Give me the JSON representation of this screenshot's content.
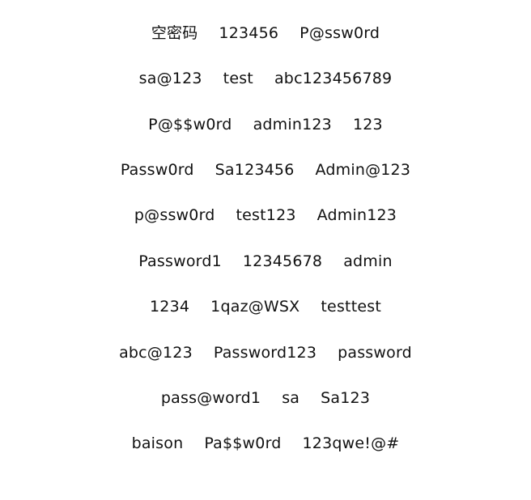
{
  "rows": [
    [
      "空密码",
      "123456",
      "P@ssw0rd"
    ],
    [
      "sa@123",
      "test",
      "abc123456789"
    ],
    [
      "P@$$w0rd",
      "admin123",
      "123"
    ],
    [
      "Passw0rd",
      "Sa123456",
      "Admin@123"
    ],
    [
      "p@ssw0rd",
      "test123",
      "Admin123"
    ],
    [
      "Password1",
      "12345678",
      "admin"
    ],
    [
      "1234",
      "1qaz@WSX",
      "testtest"
    ],
    [
      "abc@123",
      "Password123",
      "password"
    ],
    [
      "pass@word1",
      "sa",
      "Sa123"
    ],
    [
      "baison",
      "Pa$$w0rd",
      "123qwe!@#"
    ]
  ]
}
